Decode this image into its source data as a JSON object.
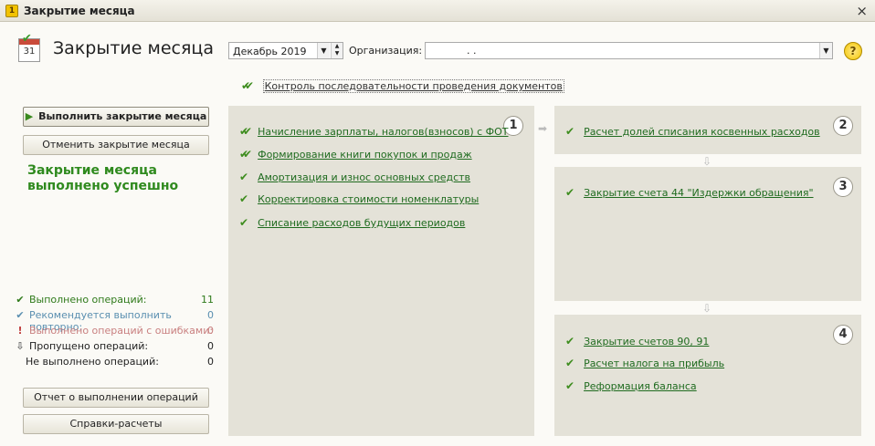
{
  "window": {
    "title": "Закрытие месяца",
    "close": "×"
  },
  "header": {
    "page_title": "Закрытие месяца",
    "calendar_icon_day": "31",
    "period_value": "Декабрь 2019",
    "org_label": "Организация:",
    "org_value": ". .",
    "help": "?"
  },
  "control_link": "Контроль последовательности проведения документов",
  "actions": {
    "run": "Выполнить закрытие месяца",
    "cancel": "Отменить закрытие месяца",
    "report": "Отчет о выполнении операций",
    "calc": "Справки-расчеты"
  },
  "status_message": "Закрытие месяца выполнено успешно",
  "stats": [
    {
      "label": "Выполнено операций:",
      "count": "11",
      "color": "#2f7a1a",
      "icon": "check-icon"
    },
    {
      "label": "Рекомендуется выполнить повторно:",
      "count": "0",
      "color": "#5a8fb0",
      "icon": "check-icon"
    },
    {
      "label": "Выполнено операций с ошибками:",
      "count": "0",
      "color": "#c98080",
      "icon": "warning-icon"
    },
    {
      "label": "Пропущено операций:",
      "count": "0",
      "color": "#222222",
      "icon": "down-arrow-icon"
    },
    {
      "label": "Не выполнено операций:",
      "count": "0",
      "color": "#222222",
      "icon": "none"
    }
  ],
  "steps": {
    "step1": {
      "number": "1",
      "items": [
        "Начисление зарплаты, налогов(взносов) с ФОТ",
        "Формирование книги покупок и продаж",
        "Амортизация и износ основных средств",
        "Корректировка стоимости номенклатуры",
        "Списание расходов будущих периодов"
      ]
    },
    "step2": {
      "number": "2",
      "items": [
        "Расчет долей списания косвенных расходов"
      ]
    },
    "step3": {
      "number": "3",
      "items": [
        "Закрытие счета 44 \"Издержки обращения\""
      ]
    },
    "step4": {
      "number": "4",
      "items": [
        "Закрытие счетов 90, 91",
        "Расчет налога на прибыль",
        "Реформация баланса"
      ]
    }
  },
  "colors": {
    "accent_green": "#2f8a1e",
    "panel_bg": "#e4e2d8"
  }
}
